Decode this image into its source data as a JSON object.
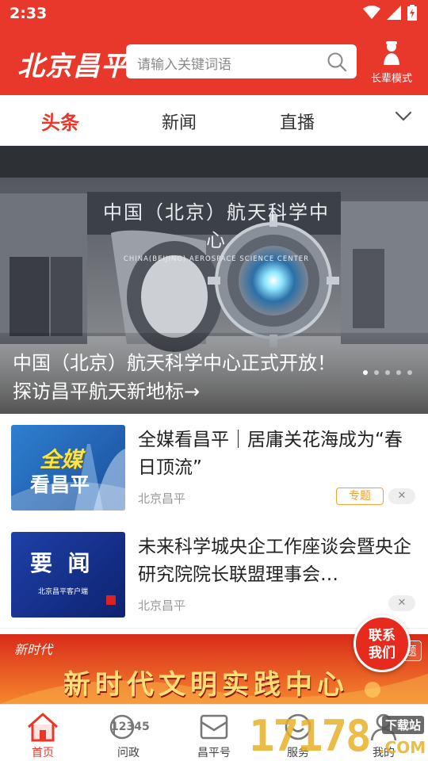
{
  "status_bar": {
    "time": "2:33"
  },
  "header": {
    "logo": "北京昌平",
    "search_placeholder": "请输入关键词语",
    "elder_mode_label": "长辈模式"
  },
  "tabs": [
    {
      "label": "头条",
      "active": true
    },
    {
      "label": "新闻",
      "active": false
    },
    {
      "label": "直播",
      "active": false
    }
  ],
  "banner": {
    "sign_cn": "中国（北京）航天科学中心",
    "sign_en": "CHINA(BEIJING) AEROSPACE SCIENCE CENTER",
    "caption": "中国（北京）航天科学中心正式开放！探访昌平航天新地标→",
    "slide_count": 5,
    "active_slide": 1
  },
  "news": [
    {
      "title": "全媒看昌平｜居庸关花海成为“春日顶流”",
      "source": "北京昌平",
      "tag": "专题",
      "thumb_text_1": "全媒",
      "thumb_text_2": "看昌平",
      "close": "✕"
    },
    {
      "title": "未来科学城央企工作座谈会暨央企研究院院长联盟理事会…",
      "source": "北京昌平",
      "thumb_text_1": "要  闻",
      "thumb_text_2": "北京昌平客户端",
      "close": "✕"
    }
  ],
  "ad": {
    "logo_text": "新时代",
    "main_text": "新时代文明实践中心",
    "special_label": "题"
  },
  "contact_button": {
    "line1": "联系",
    "line2": "我们"
  },
  "bottom_nav": [
    {
      "label": "首页",
      "active": true
    },
    {
      "label": "问政",
      "active": false,
      "badge_text": "12345"
    },
    {
      "label": "昌平号",
      "active": false
    },
    {
      "label": "服务",
      "active": false
    },
    {
      "label": "我的",
      "active": false
    }
  ],
  "watermark": {
    "text": "17178",
    "suffix": ".COM",
    "tag": "下载站"
  },
  "colors": {
    "brand_red": "#e8382b",
    "tag_orange": "#f0a030"
  }
}
